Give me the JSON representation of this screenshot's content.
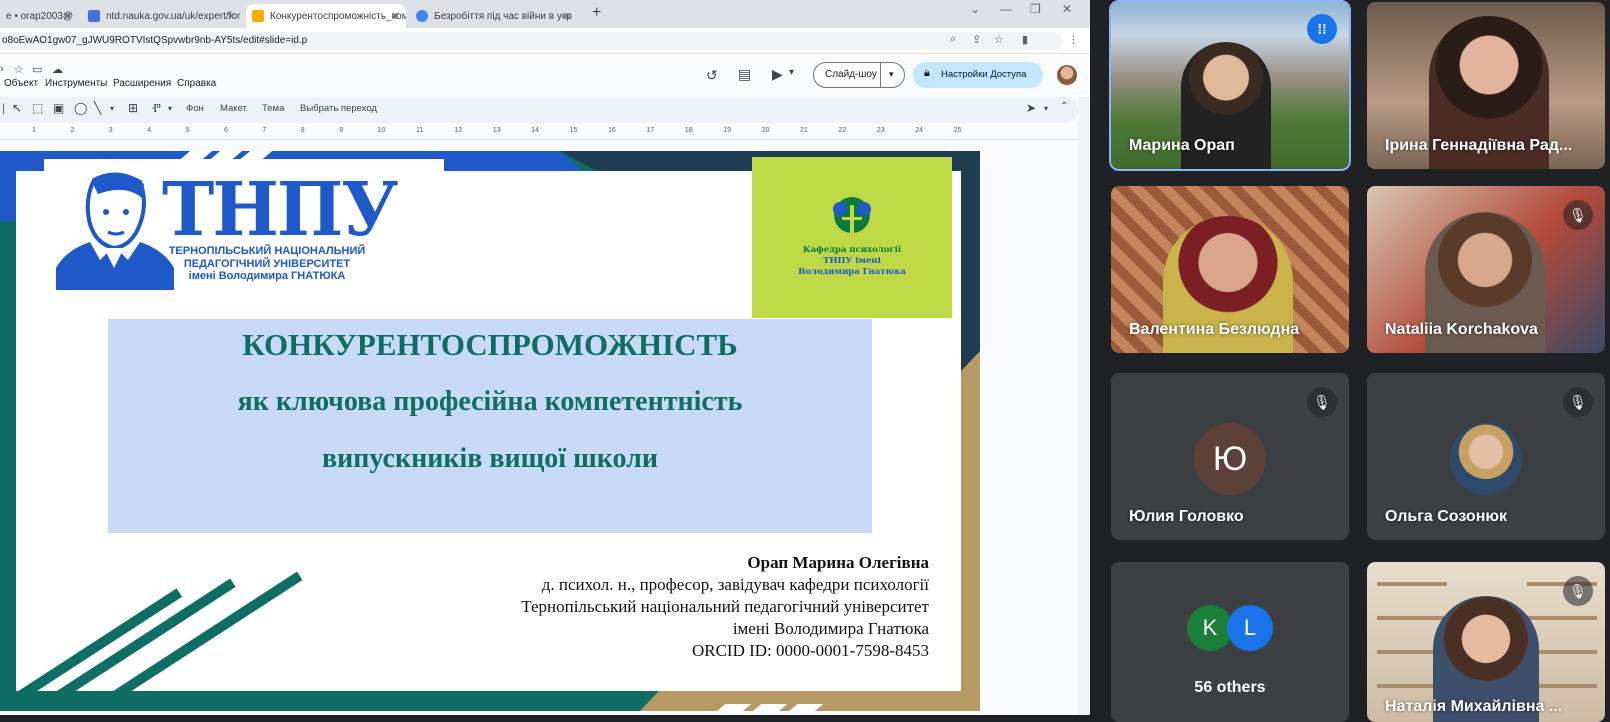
{
  "browser": {
    "tabs": [
      {
        "label": "е • orap2003@",
        "favicon_color": "#d93025"
      },
      {
        "label": "ntd.nauka.gov.ua/uk/expert/for",
        "favicon_color": "#4a6ee0"
      },
      {
        "label": "Конкурентоспроможність_ком",
        "favicon_color": "#f9ab00"
      },
      {
        "label": "Безробіття під час війни в укр",
        "favicon_color": "#4285f4"
      }
    ],
    "url": "o8oEwAO1gw07_gJWU9ROTVIstQSpvwbr9nb-AY5ts/edit#slide=id.p"
  },
  "app": {
    "menu": [
      "Объект",
      "Инструменты",
      "Расширения",
      "Справка"
    ],
    "slideshow_label": "Слайд-шоу",
    "share_label": "Настройки Доступа",
    "toolbar": {
      "background": "Фон",
      "layout": "Макет",
      "theme": "Тема",
      "transition": "Выбрать переход"
    },
    "ruler": [
      "1",
      "2",
      "3",
      "4",
      "5",
      "6",
      "7",
      "8",
      "9",
      "10",
      "11",
      "12",
      "13",
      "14",
      "15",
      "16",
      "17",
      "18",
      "19",
      "20",
      "21",
      "22",
      "23",
      "24",
      "25"
    ]
  },
  "slide": {
    "logo_text": "ТНПУ",
    "university": [
      "ТЕРНОПІЛЬСЬКИЙ НАЦІОНАЛЬНИЙ",
      "ПЕДАГОГІЧНИЙ УНІВЕРСИТЕТ",
      "імені Володимира ГНАТЮКА"
    ],
    "department": [
      "Кафедра психології",
      "ТНПУ імені",
      "Володимира Гнатюка"
    ],
    "title_lines": [
      "КОНКУРЕНТОСПРОМОЖНІСТЬ",
      "як ключова професійна компетентність",
      "випускників вищої школи"
    ],
    "author": {
      "name": "Орап Марина Олегівна",
      "lines": [
        "д. психол. н., професор, завідувач кафедри психології",
        "Тернопільський національний педагогічний університет",
        "імені Володимира Гнатюка",
        "ORCID ID: 0000-0001-7598-8453"
      ]
    },
    "colors": {
      "blue": "#1f58c9",
      "teal": "#0e6e63",
      "lime": "#bed846",
      "lavender": "#c9daf8",
      "gold": "#b59a63"
    }
  },
  "meet": {
    "participants": [
      {
        "name": "Марина Орап",
        "speaking": true
      },
      {
        "name": "Ірина Геннадіївна Рад..."
      },
      {
        "name": "Валентина Безлюдна"
      },
      {
        "name": "Nataliia Korchakova",
        "muted": true
      },
      {
        "name": "Юлия Головко",
        "initial": "Ю",
        "muted": true
      },
      {
        "name": "Ольга Созонюк",
        "muted": true
      },
      {
        "name": "Наталія Михайлівна ...",
        "muted": true
      }
    ],
    "others": {
      "label": "56 others",
      "avatars": [
        "K",
        "L"
      ]
    }
  }
}
